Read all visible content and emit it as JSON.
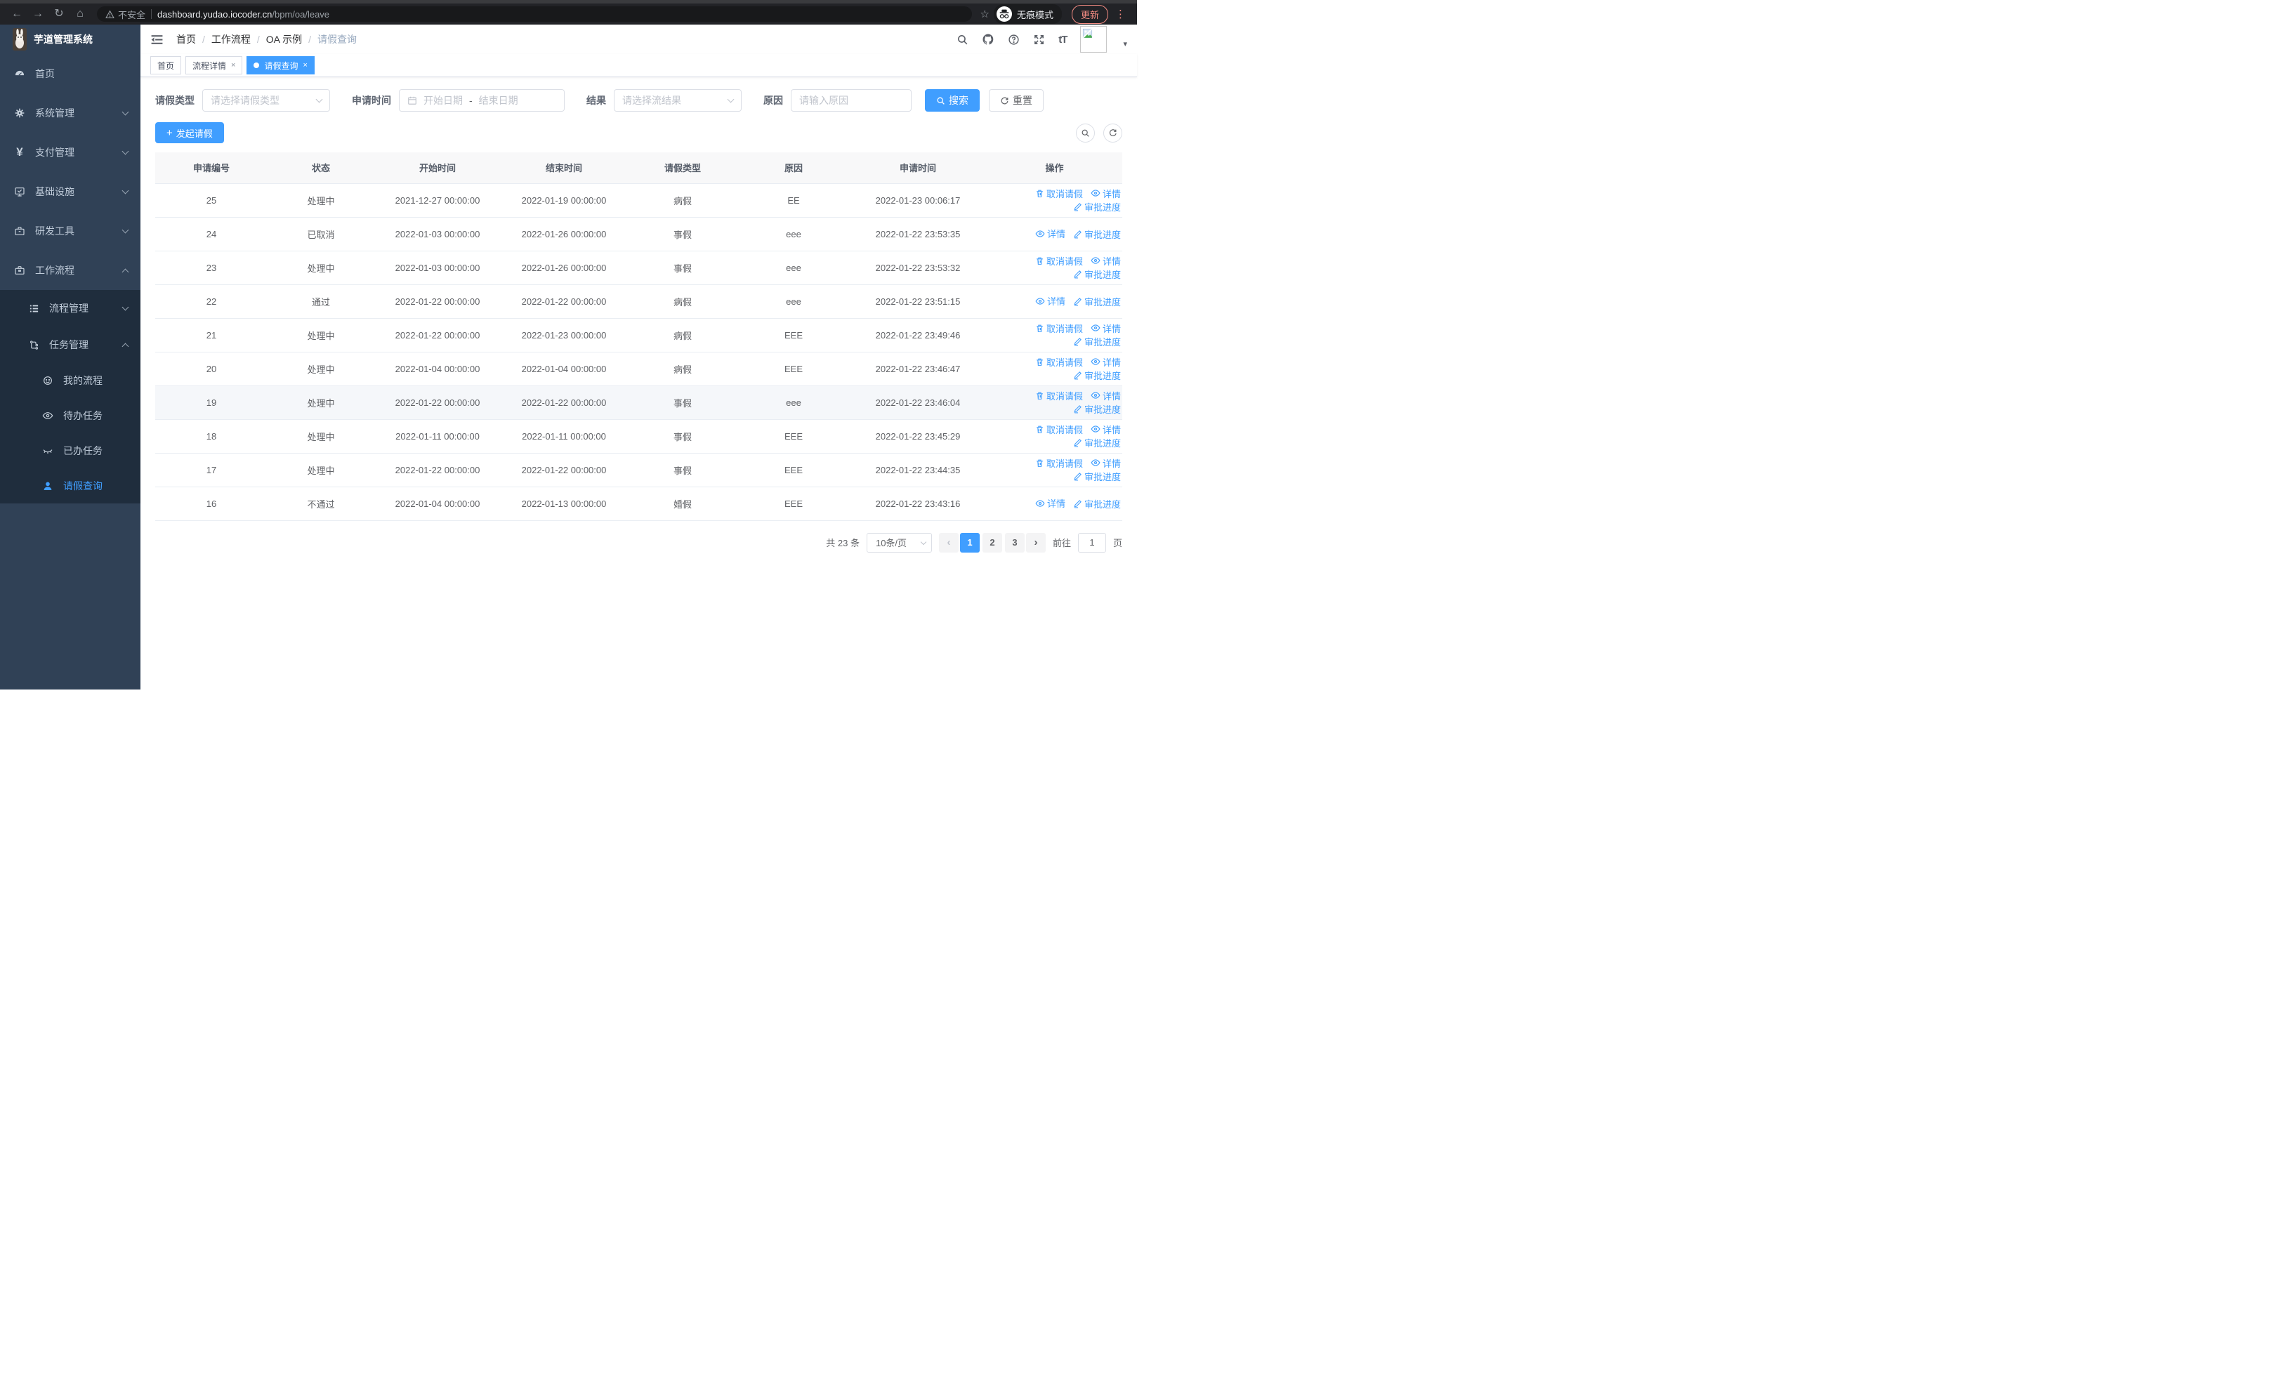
{
  "browser": {
    "security": "不安全",
    "url_host": "dashboard.yudao.iocoder.cn",
    "url_path": "/bpm/oa/leave",
    "incognito": "无痕模式",
    "update": "更新"
  },
  "icons": {
    "back": "←",
    "forward": "→",
    "reload": "↻",
    "home": "⌂",
    "star": "☆",
    "dots": "⋮",
    "caret": "▾",
    "crumb_sep": "/",
    "plus": "+",
    "yen": "¥",
    "prev": "‹",
    "next": "›",
    "font_size": "tT"
  },
  "app": {
    "title": "芋道管理系统"
  },
  "header": {
    "breadcrumb": [
      "首页",
      "工作流程",
      "OA 示例",
      "请假查询"
    ]
  },
  "sidebar": {
    "items": [
      {
        "label": "首页"
      },
      {
        "label": "系统管理"
      },
      {
        "label": "支付管理"
      },
      {
        "label": "基础设施"
      },
      {
        "label": "研发工具"
      },
      {
        "label": "工作流程"
      },
      {
        "label": "流程管理"
      },
      {
        "label": "任务管理"
      },
      {
        "label": "我的流程"
      },
      {
        "label": "待办任务"
      },
      {
        "label": "已办任务"
      },
      {
        "label": "请假查询"
      }
    ]
  },
  "tabs": {
    "items": [
      {
        "label": "首页"
      },
      {
        "label": "流程详情"
      },
      {
        "label": "请假查询"
      }
    ]
  },
  "filters": {
    "leave_type_label": "请假类型",
    "leave_type_placeholder": "请选择请假类型",
    "apply_time_label": "申请时间",
    "start_placeholder": "开始日期",
    "range_separator": "-",
    "end_placeholder": "结束日期",
    "result_label": "结果",
    "result_placeholder": "请选择流结果",
    "reason_label": "原因",
    "reason_placeholder": "请输入原因",
    "search": "搜索",
    "reset": "重置"
  },
  "toolbar": {
    "create": "发起请假"
  },
  "table": {
    "headers": [
      "申请编号",
      "状态",
      "开始时间",
      "结束时间",
      "请假类型",
      "原因",
      "申请时间",
      "操作"
    ],
    "action_labels": {
      "cancel": "取消请假",
      "detail": "详情",
      "progress": "审批进度"
    },
    "rows": [
      {
        "id": "25",
        "status": "处理中",
        "start": "2021-12-27 00:00:00",
        "end": "2022-01-19 00:00:00",
        "type": "病假",
        "reason": "EE",
        "apply": "2022-01-23 00:06:17",
        "actions": [
          "cancel",
          "detail",
          "progress"
        ]
      },
      {
        "id": "24",
        "status": "已取消",
        "start": "2022-01-03 00:00:00",
        "end": "2022-01-26 00:00:00",
        "type": "事假",
        "reason": "eee",
        "apply": "2022-01-22 23:53:35",
        "actions": [
          "detail",
          "progress"
        ]
      },
      {
        "id": "23",
        "status": "处理中",
        "start": "2022-01-03 00:00:00",
        "end": "2022-01-26 00:00:00",
        "type": "事假",
        "reason": "eee",
        "apply": "2022-01-22 23:53:32",
        "actions": [
          "cancel",
          "detail",
          "progress"
        ]
      },
      {
        "id": "22",
        "status": "通过",
        "start": "2022-01-22 00:00:00",
        "end": "2022-01-22 00:00:00",
        "type": "病假",
        "reason": "eee",
        "apply": "2022-01-22 23:51:15",
        "actions": [
          "detail",
          "progress"
        ]
      },
      {
        "id": "21",
        "status": "处理中",
        "start": "2022-01-22 00:00:00",
        "end": "2022-01-23 00:00:00",
        "type": "病假",
        "reason": "EEE",
        "apply": "2022-01-22 23:49:46",
        "actions": [
          "cancel",
          "detail",
          "progress"
        ]
      },
      {
        "id": "20",
        "status": "处理中",
        "start": "2022-01-04 00:00:00",
        "end": "2022-01-04 00:00:00",
        "type": "病假",
        "reason": "EEE",
        "apply": "2022-01-22 23:46:47",
        "actions": [
          "cancel",
          "detail",
          "progress"
        ]
      },
      {
        "id": "19",
        "status": "处理中",
        "start": "2022-01-22 00:00:00",
        "end": "2022-01-22 00:00:00",
        "type": "事假",
        "reason": "eee",
        "apply": "2022-01-22 23:46:04",
        "actions": [
          "cancel",
          "detail",
          "progress"
        ],
        "highlight": true
      },
      {
        "id": "18",
        "status": "处理中",
        "start": "2022-01-11 00:00:00",
        "end": "2022-01-11 00:00:00",
        "type": "事假",
        "reason": "EEE",
        "apply": "2022-01-22 23:45:29",
        "actions": [
          "cancel",
          "detail",
          "progress"
        ]
      },
      {
        "id": "17",
        "status": "处理中",
        "start": "2022-01-22 00:00:00",
        "end": "2022-01-22 00:00:00",
        "type": "事假",
        "reason": "EEE",
        "apply": "2022-01-22 23:44:35",
        "actions": [
          "cancel",
          "detail",
          "progress"
        ]
      },
      {
        "id": "16",
        "status": "不通过",
        "start": "2022-01-04 00:00:00",
        "end": "2022-01-13 00:00:00",
        "type": "婚假",
        "reason": "EEE",
        "apply": "2022-01-22 23:43:16",
        "actions": [
          "detail",
          "progress"
        ]
      }
    ]
  },
  "pagination": {
    "total": "共 23 条",
    "page_size": "10条/页",
    "pages": [
      "1",
      "2",
      "3"
    ],
    "active_page": "1",
    "goto": "前往",
    "goto_value": "1",
    "unit": "页"
  },
  "colors": {
    "primary": "#409eff",
    "sidebar_bg": "#304156",
    "submenu_bg": "#1f2d3d",
    "update_accent": "#f28b82"
  }
}
